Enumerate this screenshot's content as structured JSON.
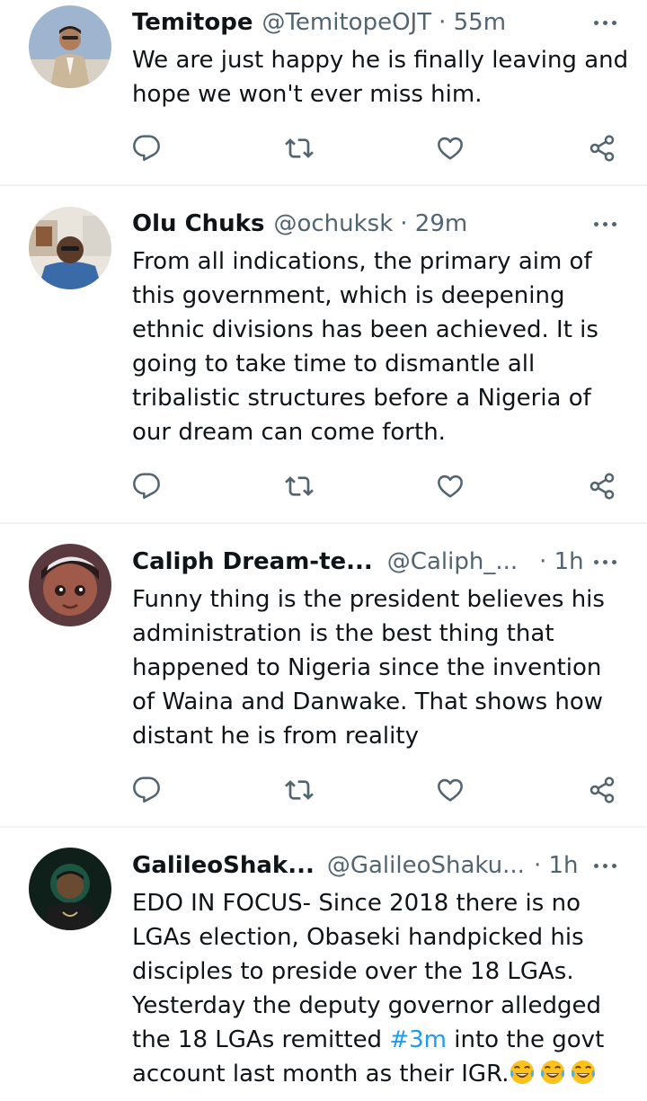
{
  "tweets": [
    {
      "name": "Temitope",
      "handle": "@TemitopeOJT",
      "time": "· 55m",
      "text": "We are just happy he is finally leaving and hope we won't ever miss him."
    },
    {
      "name": "Olu Chuks",
      "handle": "@ochuksk",
      "time": "· 29m",
      "text": "From all indications, the primary aim of this government, which is deepening ethnic divisions has been achieved. It is going to take time to dismantle all tribalistic structures before a Nigeria of our dream can come forth."
    },
    {
      "name": "Caliph Dream-te...",
      "handle": "@Caliph_...",
      "time": "· 1h",
      "text": "Funny thing is the president believes his administration is the best thing that happened to Nigeria since the invention of Waina and Danwake. That shows how distant he is from reality"
    },
    {
      "name": "GalileoShak...",
      "handle": "@GalileoShaku...",
      "time": "· 1h",
      "text_before": "EDO IN FOCUS- Since 2018 there is no LGAs election, Obaseki handpicked his disciples to preside over the 18 LGAs. Yesterday the deputy governor alledged the 18 LGAs remitted ",
      "hashtag": "#3m",
      "text_after": " into the govt account last month as their IGR."
    }
  ],
  "icons": {
    "reply": "reply-icon",
    "retweet": "retweet-icon",
    "like": "heart-icon",
    "share": "share-icon",
    "more": "more-icon",
    "emoji": "tears-of-joy-emoji"
  },
  "colors": {
    "text": "#0f1419",
    "secondary": "#536471",
    "link": "#1d9bf0",
    "divider": "#eff3f4"
  }
}
